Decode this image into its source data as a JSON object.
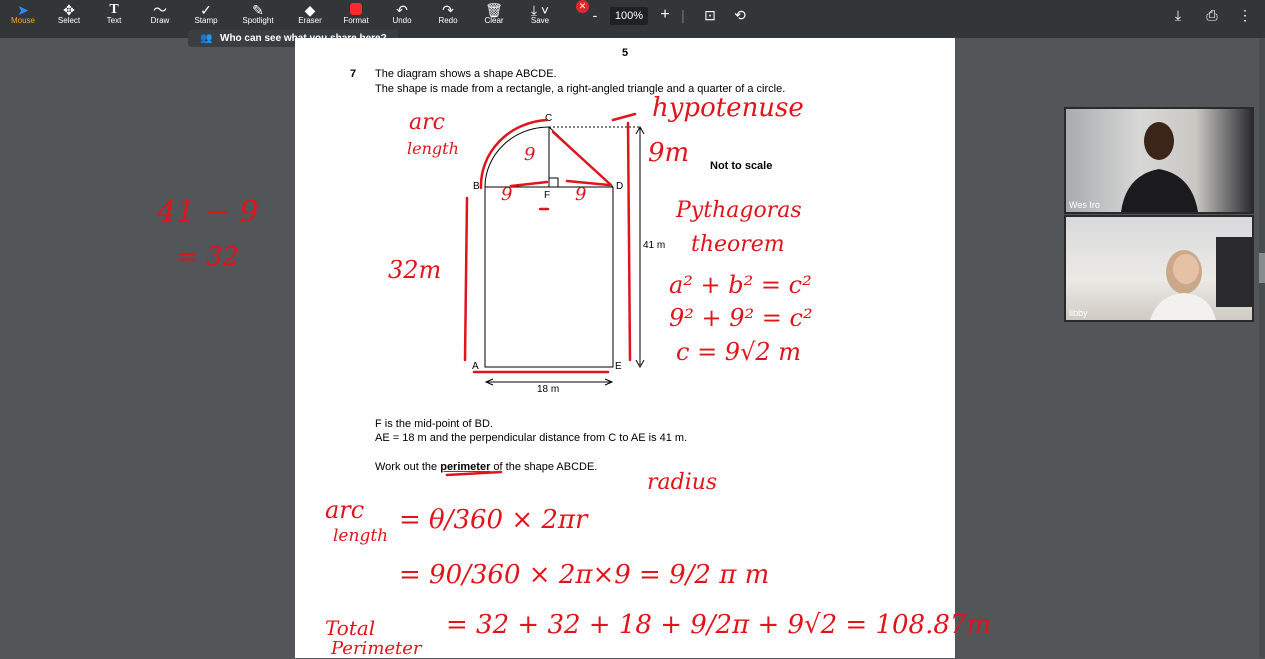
{
  "toolbar": {
    "tools": [
      {
        "label": "Mouse",
        "icon": "mouse-pointer-icon"
      },
      {
        "label": "Select",
        "icon": "move-icon"
      },
      {
        "label": "Text",
        "icon": "text-icon"
      },
      {
        "label": "Draw",
        "icon": "draw-icon"
      },
      {
        "label": "Stamp",
        "icon": "stamp-icon"
      },
      {
        "label": "Spotlight",
        "icon": "spotlight-icon"
      },
      {
        "label": "Eraser",
        "icon": "eraser-icon"
      },
      {
        "label": "Format",
        "icon": "format-icon"
      },
      {
        "label": "Undo",
        "icon": "undo-icon"
      },
      {
        "label": "Redo",
        "icon": "redo-icon"
      },
      {
        "label": "Clear",
        "icon": "trash-icon"
      },
      {
        "label": "Save",
        "icon": "save-icon"
      }
    ],
    "zoom": "100%",
    "share_notice": "Who can see what you share here?"
  },
  "document": {
    "page_number": "5",
    "question_number": "7",
    "intro_1": "The diagram shows a shape ABCDE.",
    "intro_2": "The shape is made from a rectangle, a right-angled triangle and a quarter of a circle.",
    "points": {
      "a": "A",
      "b": "B",
      "c": "C",
      "d": "D",
      "e": "E",
      "f": "F"
    },
    "not_to_scale": "Not to scale",
    "height_label": "41 m",
    "width_label": "18 m",
    "note_1": "F is the mid-point of BD.",
    "note_2": "AE = 18 m and the perpendicular distance from C to AE is 41 m.",
    "task_prefix": "Work out the ",
    "task_bold": "perimeter",
    "task_suffix": " of the shape ABCDE."
  },
  "annotations": {
    "arc1": "arc",
    "length1": "length",
    "nine_vert": "9",
    "nine_left": "9",
    "nine_right": "9",
    "hyp": "hypotenuse",
    "nine_m": "9m",
    "sub1": "41 − 9",
    "sub2": "= 32",
    "side": "32m",
    "pyth1": "Pythagoras",
    "pyth2": "theorem",
    "eq1": "a² + b² = c²",
    "eq2": "9² + 9² = c²",
    "eq3": "c = 9√2 m",
    "radius": "radius",
    "arc2": "arc",
    "length2": "length",
    "frac1": "= θ/360 × 2πr",
    "frac2": "= 90/360 × 2π×9 = 9/2 π m",
    "total": "Total",
    "perimeter": "Perimeter",
    "final": "= 32 + 32 + 18 + 9/2π + 9√2 = 108.87m"
  },
  "participants": [
    {
      "name": "Wes Iro"
    },
    {
      "name": "libby"
    }
  ],
  "colors": {
    "ink": "#e0141b",
    "toolbar": "#323639",
    "background": "#525659"
  }
}
